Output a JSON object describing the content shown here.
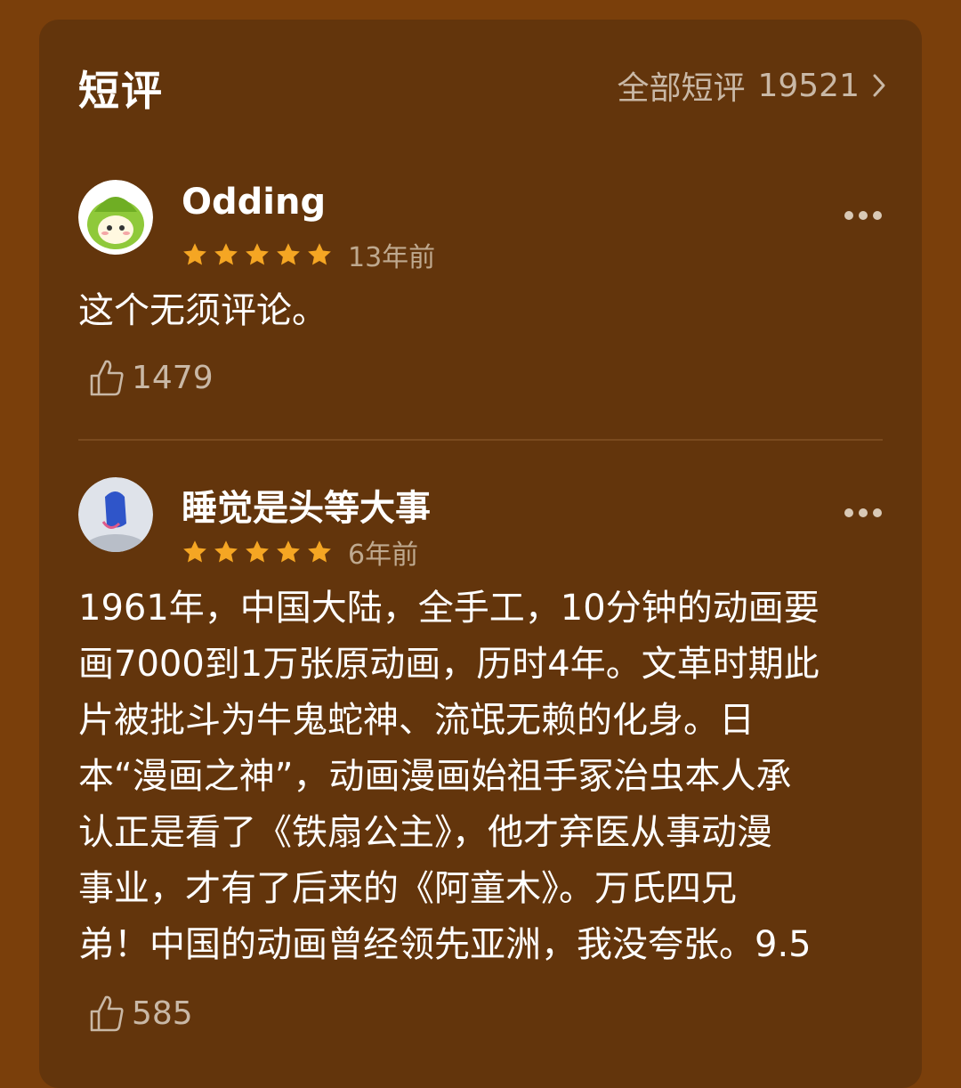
{
  "section": {
    "title": "短评",
    "all_label": "全部短评",
    "all_count": "19521"
  },
  "reviews": [
    {
      "user": "Odding",
      "rating": 5,
      "time": "13年前",
      "text": "这个无须评论。",
      "likes": "1479"
    },
    {
      "user": "睡觉是头等大事",
      "rating": 5,
      "time": "6年前",
      "text": "1961年，中国大陆，全手工，10分钟的动画要\n画7000到1万张原动画，历时4年。文革时期此\n片被批斗为牛鬼蛇神、流氓无赖的化身。日\n本“漫画之神”，动画漫画始祖手冢治虫本人承\n认正是看了《铁扇公主》，他才弃医从事动漫\n事业，才有了后来的《阿童木》。万氏四兄\n弟！中国的动画曾经领先亚洲，我没夸张。9.5",
      "likes": "585"
    }
  ],
  "colors": {
    "page_bg": "#7a3f0b",
    "card_bg": "#63350c",
    "star": "#f5a623",
    "muted": "#c9b8a6"
  },
  "icons": [
    "chevron-right-icon",
    "more-icon",
    "star-icon",
    "thumb-up-icon"
  ]
}
